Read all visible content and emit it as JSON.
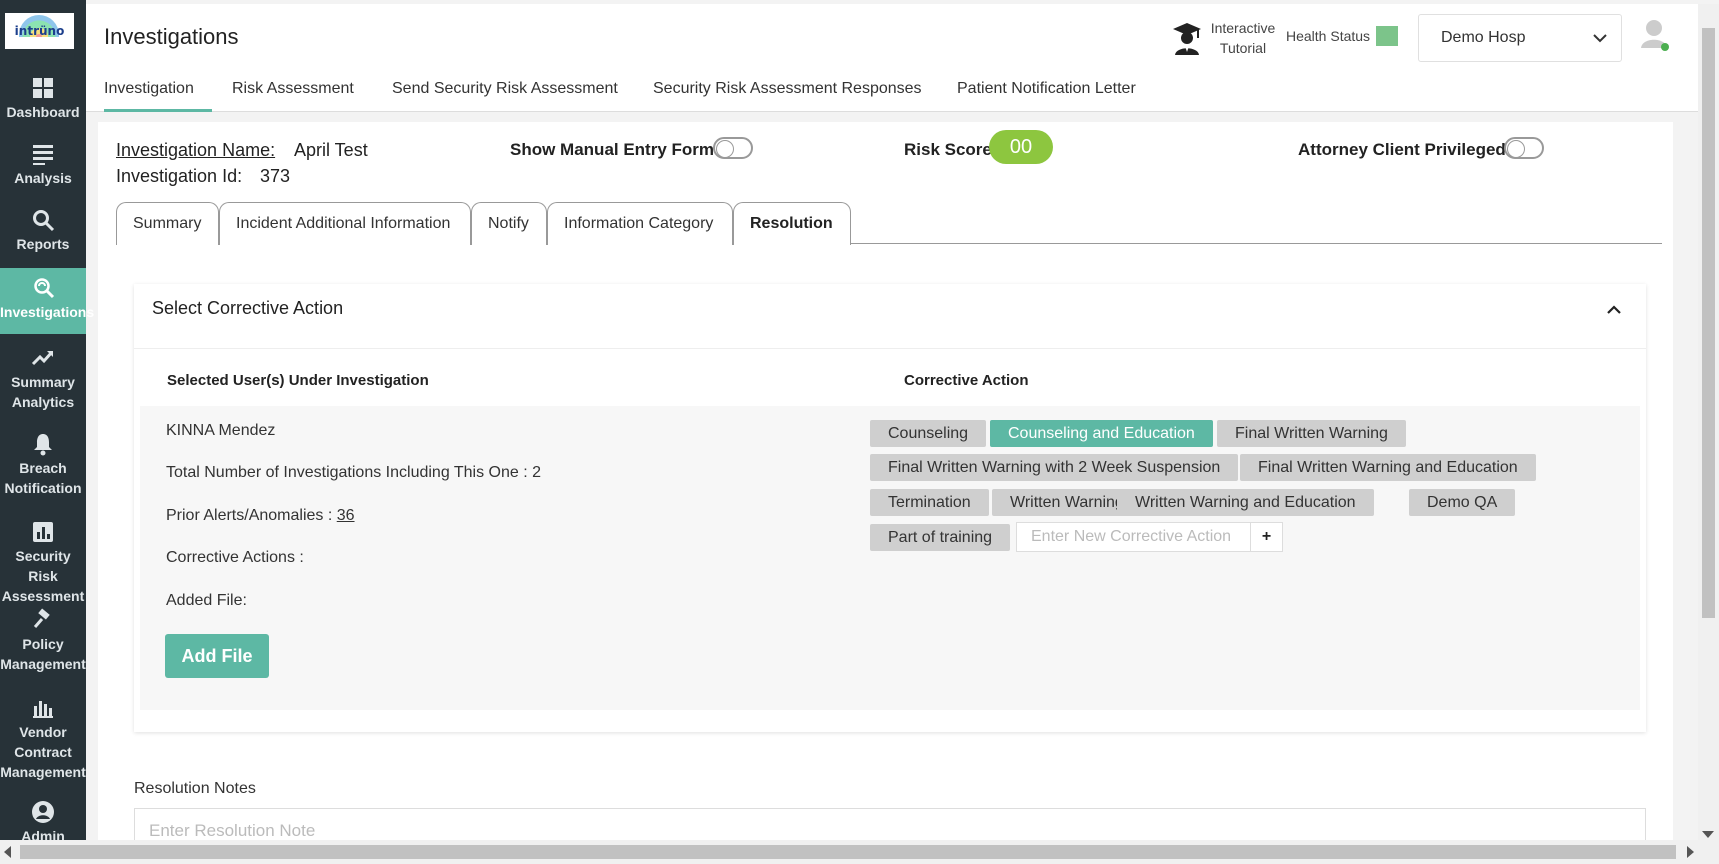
{
  "app": {
    "logo_text": "intrüno"
  },
  "sidebar": {
    "items": [
      {
        "label": "Dashboard",
        "icon": "grid-icon"
      },
      {
        "label": "Analysis",
        "icon": "list-icon"
      },
      {
        "label": "Reports",
        "icon": "search-icon"
      },
      {
        "label": "Investigations",
        "icon": "investigate-icon"
      },
      {
        "label": "Summary Analytics",
        "icon": "trend-icon"
      },
      {
        "label": "Breach Notification",
        "icon": "bell-icon"
      },
      {
        "label": "Security Risk Assessment",
        "icon": "bar-chart-icon"
      },
      {
        "label": "Policy Management",
        "icon": "gavel-icon"
      },
      {
        "label": "Vendor Contract Management",
        "icon": "bar-chart-icon"
      },
      {
        "label": "Admin",
        "icon": "user-circle-icon"
      }
    ],
    "active_index": 3,
    "active_color": "#5db8a4"
  },
  "header": {
    "title": "Investigations",
    "tutorial_label": "Interactive Tutorial",
    "health_label": "Health Status",
    "health_color": "#7cc48a",
    "hospital_selected": "Demo Hosp"
  },
  "top_tabs": [
    "Investigation",
    "Risk Assessment",
    "Send Security Risk Assessment",
    "Security Risk Assessment Responses",
    "Patient Notification Letter"
  ],
  "investigation": {
    "name_label": "Investigation Name:",
    "name_value": "April Test",
    "id_label": "Investigation Id:",
    "id_value": "373",
    "manual_entry_label": "Show Manual Entry Form",
    "risk_score_label": "Risk Score",
    "risk_score_value": "00",
    "attorney_label": "Attorney Client Privileged :"
  },
  "sub_tabs": [
    "Summary",
    "Incident Additional Information",
    "Notify",
    "Information Category",
    "Resolution"
  ],
  "corrective": {
    "panel_title": "Select Corrective Action",
    "col_users": "Selected User(s) Under Investigation",
    "col_action": "Corrective Action",
    "user_name": "KINNA Mendez",
    "total_investigations": "Total Number of Investigations Including This One : 2",
    "prior_alerts_label": "Prior Alerts/Anomalies : ",
    "prior_alerts_value": "36",
    "corrective_actions_label": "Corrective Actions :",
    "added_file_label": "Added File:",
    "add_file_button": "Add File",
    "chips": [
      "Counseling",
      "Counseling and Education",
      "Final Written Warning",
      "Final Written Warning with 2 Week Suspension",
      "Final Written Warning and Education",
      "Termination",
      "Written Warning",
      "Written Warning and Education",
      "Demo QA",
      "Part of training"
    ],
    "selected_chip": "Counseling and Education",
    "new_action_placeholder": "Enter New Corrective Action",
    "plus_label": "+"
  },
  "resolution": {
    "label": "Resolution Notes",
    "placeholder": "Enter Resolution Note"
  }
}
